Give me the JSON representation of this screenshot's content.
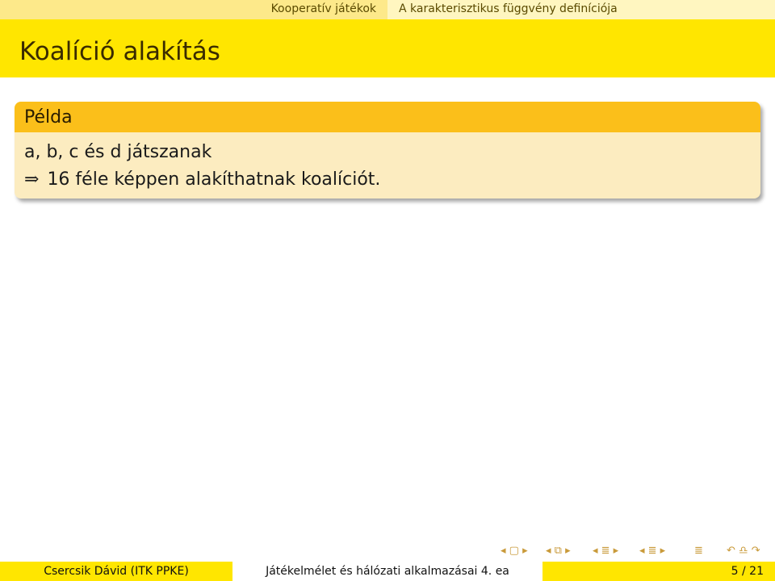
{
  "header": {
    "section": "Kooperatív játékok",
    "subsection": "A karakterisztikus függvény definíciója"
  },
  "frame": {
    "title": "Koalíció alakítás"
  },
  "block": {
    "title": "Példa",
    "line1": "a, b, c és d játszanak",
    "implies_symbol": "⇒",
    "line2": "16 féle képpen alakíthatnak koalíciót."
  },
  "navigation": {
    "frame_nav": "◂ ▢ ▸",
    "subsection_nav": "◂ ⧉ ▸",
    "section_nav": "◂ ≣ ▸",
    "subsection_list_nav": "◂ ≣ ▸",
    "doc_nav": "≣",
    "search_nav": "↶ ♎ ↷"
  },
  "footer": {
    "author": "Csercsik Dávid (ITK PPKE)",
    "title": "Játékelmélet és hálózati alkalmazásai 4. ea",
    "page": "5 / 21"
  }
}
